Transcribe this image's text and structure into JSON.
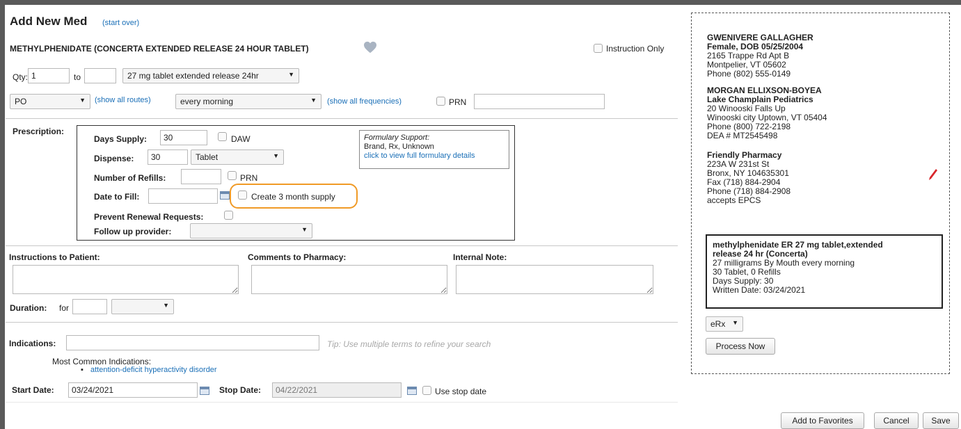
{
  "header": {
    "title": "Add New Med",
    "start_over": "(start over)",
    "drug_name": "METHYLPHENIDATE (CONCERTA EXTENDED RELEASE 24 HOUR TABLET)",
    "instruction_only": "Instruction Only"
  },
  "dose": {
    "qty_label": "Qty:",
    "qty_from": "1",
    "to_label": "to",
    "qty_to": "",
    "form": "27 mg tablet extended release 24hr",
    "route": "PO",
    "show_routes": "(show all routes)",
    "frequency": "every morning",
    "show_frequencies": "(show all frequencies)",
    "prn_label": "PRN",
    "prn_text": ""
  },
  "prescription": {
    "section_label": "Prescription:",
    "days_supply_label": "Days Supply:",
    "days_supply": "30",
    "daw_label": "DAW",
    "dispense_label": "Dispense:",
    "dispense": "30",
    "dispense_unit": "Tablet",
    "refills_label": "Number of Refills:",
    "refills": "",
    "refills_prn": "PRN",
    "date_to_fill_label": "Date to Fill:",
    "date_to_fill": "",
    "three_month_label": "Create 3 month supply",
    "prevent_renewal_label": "Prevent Renewal Requests:",
    "follow_up_label": "Follow up provider:",
    "follow_up": "",
    "formulary_title": "Formulary Support:",
    "formulary_text": "Brand, Rx, Unknown",
    "formulary_link": "click to view full formulary details"
  },
  "notes": {
    "instructions_label": "Instructions to Patient:",
    "comments_label": "Comments to Pharmacy:",
    "internal_label": "Internal Note:",
    "duration_label": "Duration:",
    "duration_for": "for",
    "duration_value": "",
    "duration_unit": ""
  },
  "indications": {
    "label": "Indications:",
    "value": "",
    "tip": "Tip: Use multiple terms to refine your search",
    "common_label": "Most Common Indications:",
    "common_items": [
      "attention-deficit hyperactivity disorder"
    ],
    "start_label": "Start Date:",
    "start_date": "03/24/2021",
    "stop_label": "Stop Date:",
    "stop_date": "04/22/2021",
    "use_stop_label": "Use stop date"
  },
  "patient": {
    "name": "GWENIVERE GALLAGHER",
    "demo": "Female, DOB 05/25/2004",
    "addr1": "2165 Trappe Rd Apt B",
    "addr2": "Montpelier, VT 05602",
    "phone": "Phone (802) 555-0149"
  },
  "prescriber": {
    "name": "MORGAN ELLIXSON-BOYEA",
    "practice": "Lake Champlain Pediatrics",
    "addr1": "20 Winooski Falls Up",
    "addr2": "Winooski city Uptown, VT 05404",
    "phone": "Phone (800) 722-2198",
    "dea": "DEA # MT2545498"
  },
  "pharmacy": {
    "name": "Friendly Pharmacy",
    "addr1": "223A W 231st St",
    "addr2": "Bronx, NY 104635301",
    "fax": "Fax (718) 884-2904",
    "phone": "Phone (718) 884-2908",
    "epcs": "accepts EPCS"
  },
  "summary": {
    "title1": "methylphenidate ER 27 mg tablet,extended",
    "title2": "release 24 hr (Concerta)",
    "sig": "27 milligrams By Mouth every morning",
    "qty": "30 Tablet, 0 Refills",
    "days": "Days Supply: 30",
    "written": "Written Date: 03/24/2021"
  },
  "actions": {
    "send_method": "eRx",
    "process_now": "Process Now",
    "add_favorites": "Add to Favorites",
    "cancel": "Cancel",
    "save": "Save"
  },
  "colors": {
    "link": "#1a6fb7",
    "highlight": "#f09a26",
    "pencil": "#d9262b"
  }
}
